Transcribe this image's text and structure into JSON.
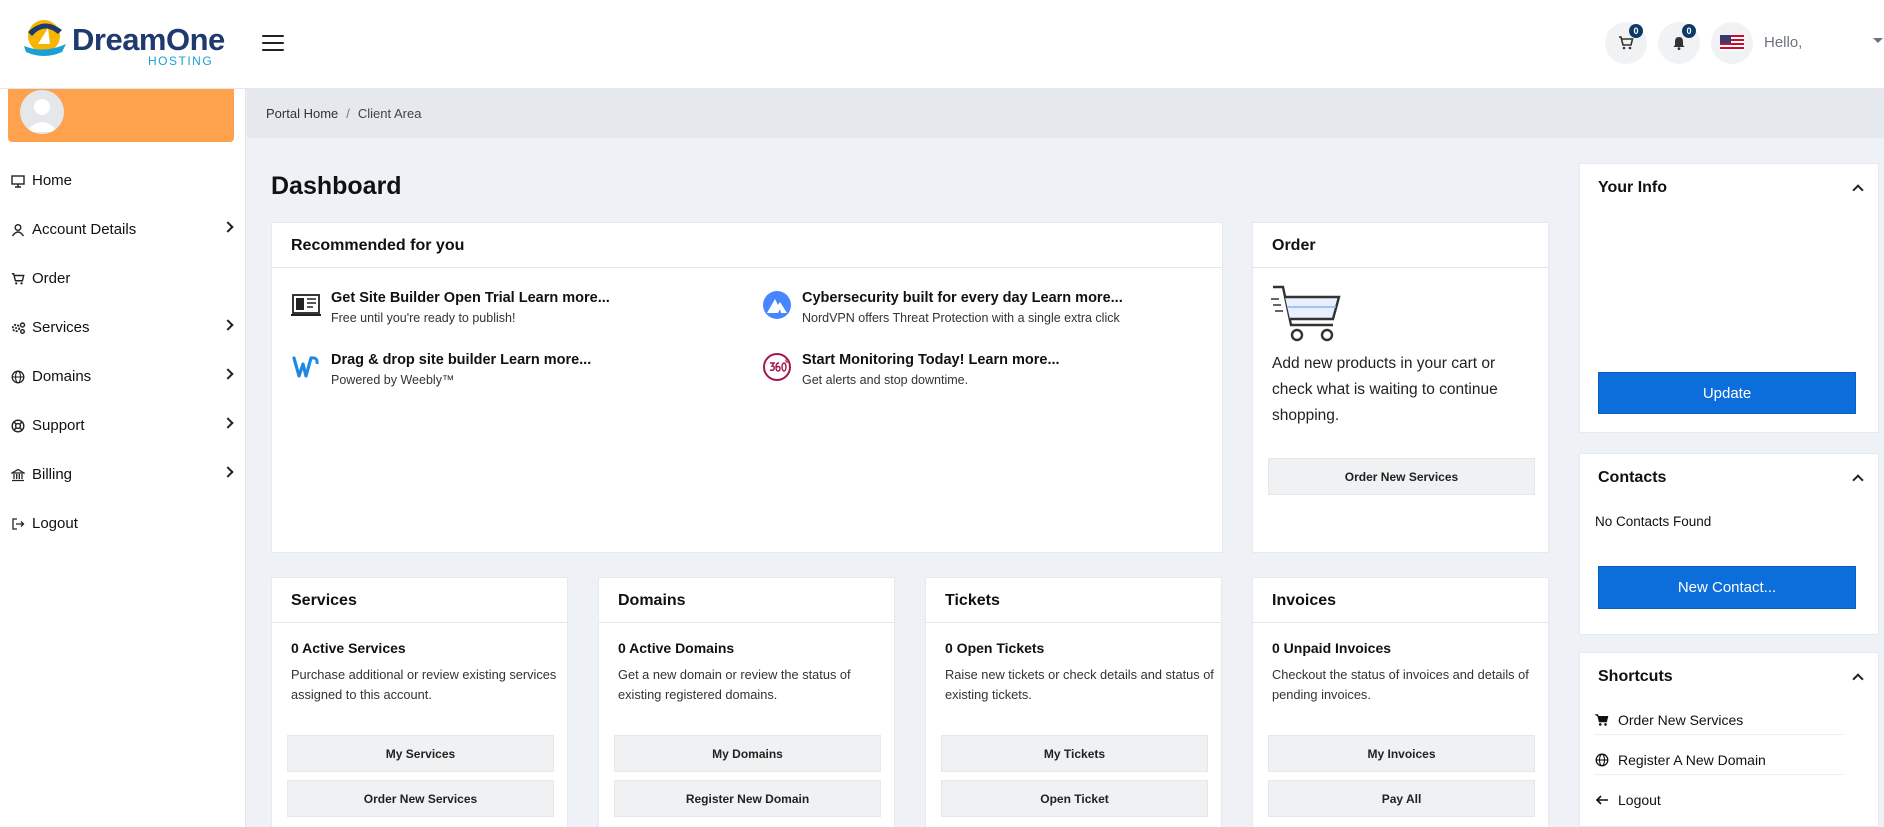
{
  "header": {
    "brand": "DreamOne",
    "brand_sub": "HOSTING",
    "cart_count": "0",
    "notif_count": "0",
    "greeting": "Hello,"
  },
  "sidebar": {
    "items": [
      {
        "label": "Home",
        "icon": "monitor-icon",
        "has_submenu": false
      },
      {
        "label": "Account Details",
        "icon": "user-icon",
        "has_submenu": true
      },
      {
        "label": "Order",
        "icon": "cart-icon",
        "has_submenu": false
      },
      {
        "label": "Services",
        "icon": "gears-icon",
        "has_submenu": true
      },
      {
        "label": "Domains",
        "icon": "globe-icon",
        "has_submenu": true
      },
      {
        "label": "Support",
        "icon": "lifebuoy-icon",
        "has_submenu": true
      },
      {
        "label": "Billing",
        "icon": "bank-icon",
        "has_submenu": true
      },
      {
        "label": "Logout",
        "icon": "logout-icon",
        "has_submenu": false
      }
    ]
  },
  "breadcrumb": {
    "home": "Portal Home",
    "separator": "/",
    "current": "Client Area"
  },
  "page": {
    "title": "Dashboard"
  },
  "recommended": {
    "title": "Recommended for you",
    "items": [
      {
        "title": "Get Site Builder Open Trial Learn more...",
        "subtitle": "Free until you're ready to publish!",
        "icon": "site-builder-icon"
      },
      {
        "title": "Cybersecurity built for every day Learn more...",
        "subtitle": "NordVPN offers Threat Protection with a single extra click",
        "icon": "nordvpn-icon"
      },
      {
        "title": "Drag & drop site builder Learn more...",
        "subtitle": "Powered by Weebly™",
        "icon": "weebly-icon"
      },
      {
        "title": "Start Monitoring Today! Learn more...",
        "subtitle": "Get alerts and stop downtime.",
        "icon": "monitoring-360-icon"
      }
    ]
  },
  "order": {
    "title": "Order",
    "text": "Add new products in your cart or check what is waiting to continue shopping.",
    "button": "Order New Services"
  },
  "stats": [
    {
      "title": "Services",
      "count": "0 Active Services",
      "desc": "Purchase additional or review existing services assigned to this account.",
      "btn1": "My Services",
      "btn2": "Order New Services"
    },
    {
      "title": "Domains",
      "count": "0 Active Domains",
      "desc": "Get a new domain or review the status of existing registered domains.",
      "btn1": "My Domains",
      "btn2": "Register New Domain"
    },
    {
      "title": "Tickets",
      "count": "0 Open Tickets",
      "desc": "Raise new tickets or check details and status of existing tickets.",
      "btn1": "My Tickets",
      "btn2": "Open Ticket"
    },
    {
      "title": "Invoices",
      "count": "0 Unpaid Invoices",
      "desc": "Checkout the status of invoices and details of pending invoices.",
      "btn1": "My Invoices",
      "btn2": "Pay All"
    }
  ],
  "your_info": {
    "title": "Your Info",
    "button": "Update"
  },
  "contacts": {
    "title": "Contacts",
    "empty": "No Contacts Found",
    "button": "New Contact..."
  },
  "shortcuts": {
    "title": "Shortcuts",
    "items": [
      {
        "label": "Order New Services",
        "icon": "cart-icon"
      },
      {
        "label": "Register A New Domain",
        "icon": "globe-icon"
      },
      {
        "label": "Logout",
        "icon": "arrow-left-icon"
      }
    ]
  },
  "colors": {
    "accent_blue": "#0c6edb",
    "profile_orange": "#ffa24e",
    "brand_navy": "#1e3a6e",
    "brand_cyan": "#1a9fd6"
  }
}
